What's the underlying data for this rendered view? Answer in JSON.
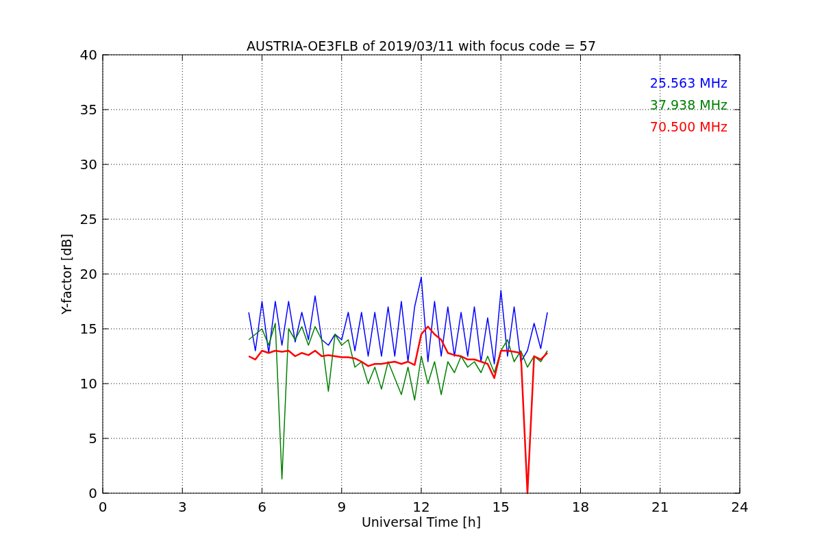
{
  "chart": {
    "chart_data": {
      "type": "line",
      "title": "AUSTRIA-OE3FLB of 2019/03/11 with focus code = 57",
      "xlabel": "Universal Time [h]",
      "ylabel": "Y-factor [dB]",
      "x": [
        5.5,
        5.75,
        6,
        6.25,
        6.5,
        6.75,
        7,
        7.25,
        7.5,
        7.75,
        8,
        8.25,
        8.5,
        8.75,
        9,
        9.25,
        9.5,
        9.75,
        10,
        10.25,
        10.5,
        10.75,
        11,
        11.25,
        11.5,
        11.75,
        12,
        12.25,
        12.5,
        12.75,
        13,
        13.25,
        13.5,
        13.75,
        14,
        14.25,
        14.5,
        14.75,
        15,
        15.25,
        15.5,
        15.75,
        16,
        16.25,
        16.5,
        16.75
      ],
      "series": [
        {
          "name": "25.563 MHz",
          "color": "#0000ff",
          "values": [
            16.5,
            13,
            17.5,
            12.8,
            17.5,
            13.5,
            17.5,
            13.8,
            16.5,
            14,
            18,
            14,
            13.5,
            14.5,
            14,
            16.5,
            13,
            16.5,
            12.5,
            16.5,
            12.5,
            17,
            12.5,
            17.5,
            12,
            17,
            19.7,
            12,
            17.5,
            12.5,
            17,
            12.5,
            16.5,
            12.5,
            17,
            12,
            16,
            11.8,
            18.5,
            12.5,
            17,
            12,
            13,
            15.5,
            13.2,
            16.5
          ]
        },
        {
          "name": "37.938 MHz",
          "color": "#008000",
          "values": [
            14,
            14.5,
            15,
            13.5,
            15.5,
            1.3,
            15,
            14,
            15.2,
            13.5,
            15.2,
            14,
            9.3,
            14.5,
            13.5,
            14,
            11.5,
            12,
            10,
            11.5,
            9.5,
            12,
            10.5,
            9,
            11.5,
            8.5,
            12.5,
            10,
            12,
            9,
            12,
            11,
            12.5,
            11.5,
            12,
            11,
            12.5,
            11,
            13,
            14,
            12,
            13,
            11.5,
            12.5,
            12,
            13
          ]
        },
        {
          "name": "70.500 MHz",
          "color": "#ff0000",
          "values": [
            12.5,
            12.2,
            13,
            12.8,
            13,
            12.9,
            13,
            12.5,
            12.8,
            12.6,
            13,
            12.5,
            12.6,
            12.5,
            12.4,
            12.4,
            12.3,
            12,
            11.6,
            11.8,
            11.8,
            11.9,
            12,
            11.8,
            12,
            11.7,
            14.5,
            15.2,
            14.5,
            14,
            12.8,
            12.6,
            12.5,
            12.2,
            12.2,
            12,
            11.8,
            10.5,
            13,
            13,
            12.9,
            12.8,
            0,
            12.5,
            12.2,
            12.8
          ]
        }
      ],
      "grid": true,
      "xlim": [
        0,
        24
      ],
      "ylim": [
        0,
        40
      ],
      "xticks": [
        0,
        3,
        6,
        9,
        12,
        15,
        18,
        21,
        24
      ],
      "yticks": [
        0,
        5,
        10,
        15,
        20,
        25,
        30,
        35,
        40
      ]
    }
  }
}
